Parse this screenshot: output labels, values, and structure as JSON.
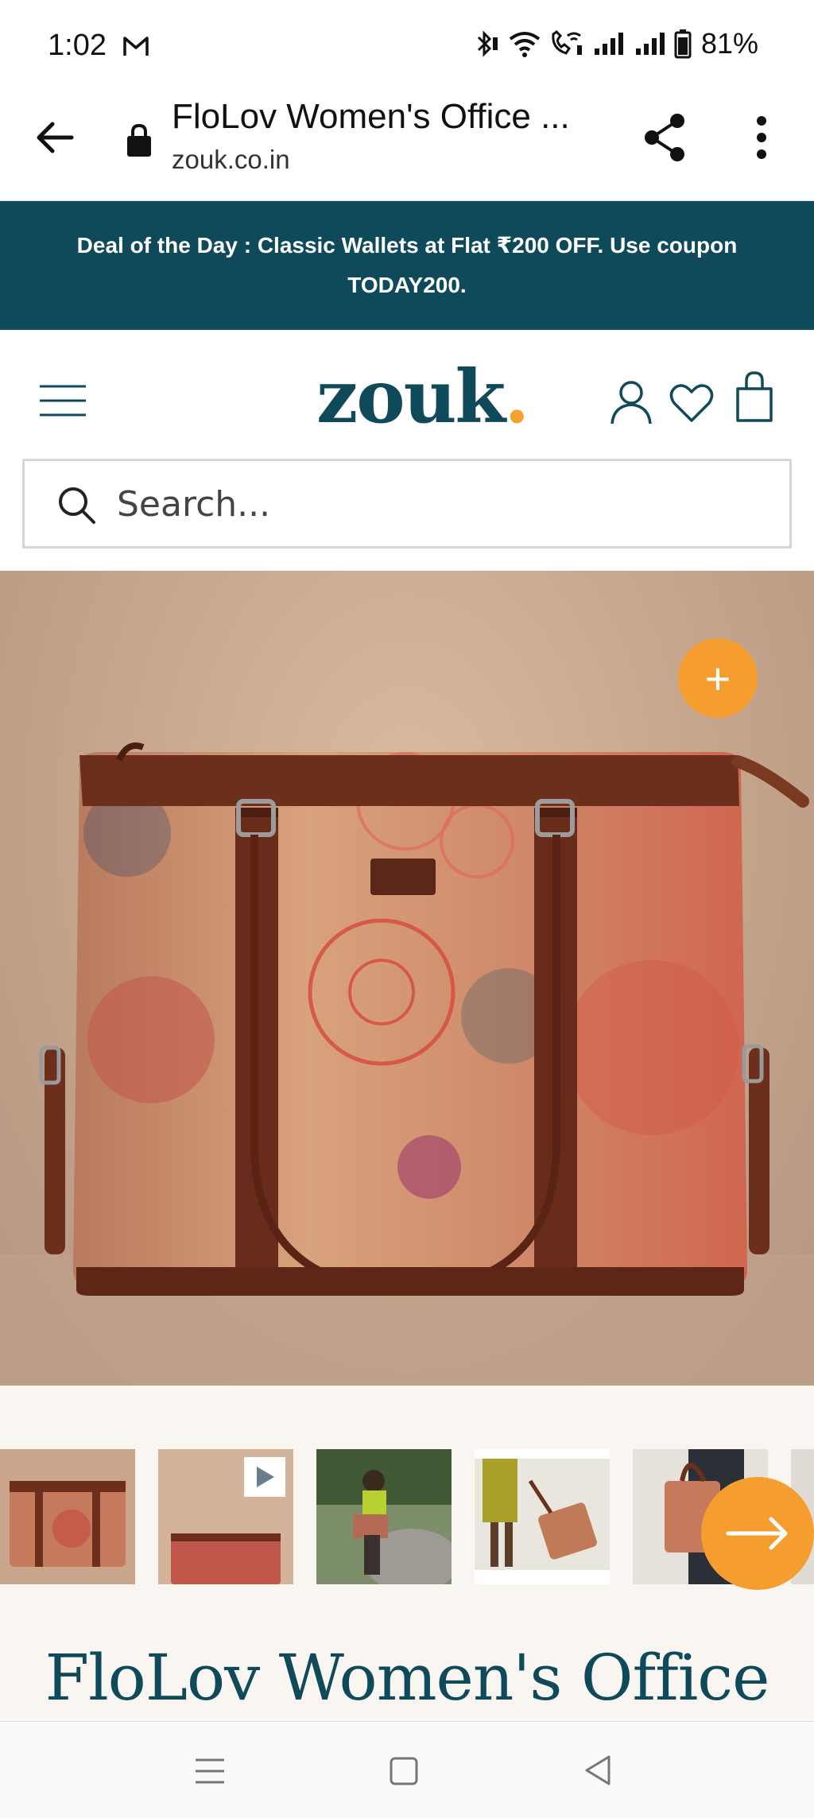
{
  "status_bar": {
    "time": "1:02",
    "battery": "81%"
  },
  "browser": {
    "page_title": "FloLov Women's Office ...",
    "host": "zouk.co.in"
  },
  "promo": {
    "text": "Deal of the Day : Classic Wallets at Flat ₹200 OFF. Use coupon TODAY200."
  },
  "header": {
    "logo": "zouk",
    "logo_dot": "."
  },
  "search": {
    "placeholder": "Search..."
  },
  "product": {
    "zoom_label": "+",
    "title": "FloLov Women's Office",
    "thumbnail_count": 6
  },
  "colors": {
    "brand_teal": "#0f4a5a",
    "accent_orange": "#f59e2f"
  },
  "icons": [
    "gmail-icon",
    "bluetooth-icon",
    "wifi-icon",
    "wifi-call-icon",
    "signal-icon",
    "battery-icon",
    "back-arrow-icon",
    "lock-icon",
    "share-icon",
    "more-vert-icon",
    "hamburger-menu-icon",
    "user-icon",
    "heart-icon",
    "shopping-bag-icon",
    "search-icon",
    "plus-icon",
    "play-icon",
    "arrow-right-icon",
    "nav-recents-icon",
    "nav-home-icon",
    "nav-back-icon"
  ]
}
